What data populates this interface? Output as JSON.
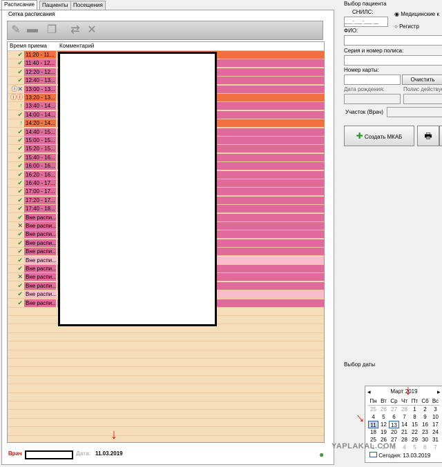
{
  "tabs": [
    "Расписание",
    "Пациенты",
    "Посещения"
  ],
  "schedule": {
    "group_title": "Сетка расписания",
    "col_time": "Время приема",
    "col_comment": "Комментарий",
    "rows": [
      {
        "icon": "✔",
        "icon_color": "#2a9a2a",
        "time": "11:20 - 11...",
        "bg": "#f07040"
      },
      {
        "icon": "✔",
        "icon_color": "#2a9a2a",
        "time": "11:40 - 12...",
        "bg": "#e06a9a"
      },
      {
        "icon": "✔",
        "icon_color": "#2a9a2a",
        "time": "12:20 - 12...",
        "bg": "#e06a9a"
      },
      {
        "icon": "✔",
        "icon_color": "#2a9a2a",
        "time": "12:40 - 13...",
        "bg": "#e06a9a"
      },
      {
        "icon": "ⓘ✕",
        "icon_color": "#2060c0",
        "time": "13:00 - 13...",
        "bg": "#e06a9a"
      },
      {
        "icon": "ⓘⓘ",
        "icon_color": "#d02020",
        "time": "13:20 - 13...",
        "bg": "#f07040"
      },
      {
        "icon": "↑",
        "icon_color": "#2a9a2a",
        "time": "13:40 - 14...",
        "bg": "#e06a9a"
      },
      {
        "icon": "✔",
        "icon_color": "#2a9a2a",
        "time": "14:00 - 14...",
        "bg": "#e06a9a"
      },
      {
        "icon": "↑",
        "icon_color": "#2a9a2a",
        "time": "14:20 - 14...",
        "bg": "#f07040"
      },
      {
        "icon": "✔",
        "icon_color": "#2a9a2a",
        "time": "14:40 - 15...",
        "bg": "#e06a9a"
      },
      {
        "icon": "✔",
        "icon_color": "#2a9a2a",
        "time": "15:00 - 15...",
        "bg": "#e06a9a"
      },
      {
        "icon": "✔",
        "icon_color": "#2a9a2a",
        "time": "15:20 - 15...",
        "bg": "#e06a9a"
      },
      {
        "icon": "✔",
        "icon_color": "#2a9a2a",
        "time": "15:40 - 16...",
        "bg": "#e06a9a"
      },
      {
        "icon": "✔",
        "icon_color": "#2a9a2a",
        "time": "16:00 - 16...",
        "bg": "#e06a9a"
      },
      {
        "icon": "✔",
        "icon_color": "#2a9a2a",
        "time": "16:20 - 16...",
        "bg": "#e06a9a"
      },
      {
        "icon": "✔",
        "icon_color": "#2a9a2a",
        "time": "16:40 - 17...",
        "bg": "#e06a9a"
      },
      {
        "icon": "✔",
        "icon_color": "#2a9a2a",
        "time": "17:00 - 17...",
        "bg": "#e06a9a"
      },
      {
        "icon": "✔",
        "icon_color": "#2a9a2a",
        "time": "17:20 - 17...",
        "bg": "#e06a9a"
      },
      {
        "icon": "✔",
        "icon_color": "#2a9a2a",
        "time": "17:40 - 18...",
        "bg": "#e06a9a"
      },
      {
        "icon": "✔",
        "icon_color": "#2a9a2a",
        "time": "Вне распи...",
        "bg": "#e06a9a"
      },
      {
        "icon": "✕",
        "icon_color": "#404040",
        "time": "Вне распи...",
        "bg": "#e06a9a"
      },
      {
        "icon": "✔",
        "icon_color": "#2a9a2a",
        "time": "Вне распи...",
        "bg": "#e06a9a"
      },
      {
        "icon": "✔",
        "icon_color": "#2a9a2a",
        "time": "Вне распи...",
        "bg": "#e06a9a"
      },
      {
        "icon": "✔",
        "icon_color": "#2a9a2a",
        "time": "Вне распи...",
        "bg": "#e06a9a"
      },
      {
        "icon": "✔",
        "icon_color": "#2a9a2a",
        "time": "Вне распи...",
        "bg": "#f8bccc"
      },
      {
        "icon": "✔",
        "icon_color": "#2a9a2a",
        "time": "Вне распи...",
        "bg": "#e06a9a"
      },
      {
        "icon": "✕",
        "icon_color": "#404040",
        "time": "Вне распи...",
        "bg": "#e06a9a"
      },
      {
        "icon": "✔",
        "icon_color": "#2a9a2a",
        "time": "Вне распи...",
        "bg": "#e06a9a"
      },
      {
        "icon": "✔",
        "icon_color": "#2a9a2a",
        "time": "Вне распи...",
        "bg": "#f8bccc"
      },
      {
        "icon": "✔",
        "icon_color": "#2a9a2a",
        "time": "Вне распи...",
        "bg": "#e06a9a"
      }
    ]
  },
  "footer": {
    "doctor_label": "Врач",
    "date_label": "Дата:",
    "date_value": "11.03.2019"
  },
  "patient": {
    "group_title": "Выбор пациента",
    "snils_label": "СНИЛС:",
    "snils_placeholder": "___-___-___ __",
    "radio_med": "Медицинские к",
    "radio_reg": "Регистр",
    "fio_label": "ФИО:",
    "policy_label": "Серия и номер полиса:",
    "card_label": "Номер карты:",
    "clear_button": "Очистить",
    "birth_label": "Дата рождения:",
    "policy_valid_label": "Полис действуе",
    "district_label": "Участок (Врач)",
    "create_mkab_button": "Создать МКАБ"
  },
  "calendar": {
    "group_title": "Выбор даты",
    "month": "Март 2019",
    "weekdays": [
      "Пн",
      "Вт",
      "Ср",
      "Чт",
      "Пт",
      "Сб",
      "Вс"
    ],
    "weeks": [
      [
        "25",
        "26",
        "27",
        "28",
        "1",
        "2",
        "3"
      ],
      [
        "4",
        "5",
        "6",
        "7",
        "8",
        "9",
        "10"
      ],
      [
        "11",
        "12",
        "13",
        "14",
        "15",
        "16",
        "17"
      ],
      [
        "18",
        "19",
        "20",
        "21",
        "22",
        "23",
        "24"
      ],
      [
        "25",
        "26",
        "27",
        "28",
        "29",
        "30",
        "31"
      ],
      [
        "1",
        "2",
        "3",
        "4",
        "5",
        "6",
        "7"
      ]
    ],
    "today_label": "Сегодня: 13.03.2019"
  },
  "watermark": "YAPLAKAL.COM",
  "colors": {
    "accent_red": "#e01010",
    "row_orange": "#f07040",
    "row_pink": "#e06a9a",
    "row_light_pink": "#f8bccc",
    "grid_bg": "#f7deba"
  }
}
